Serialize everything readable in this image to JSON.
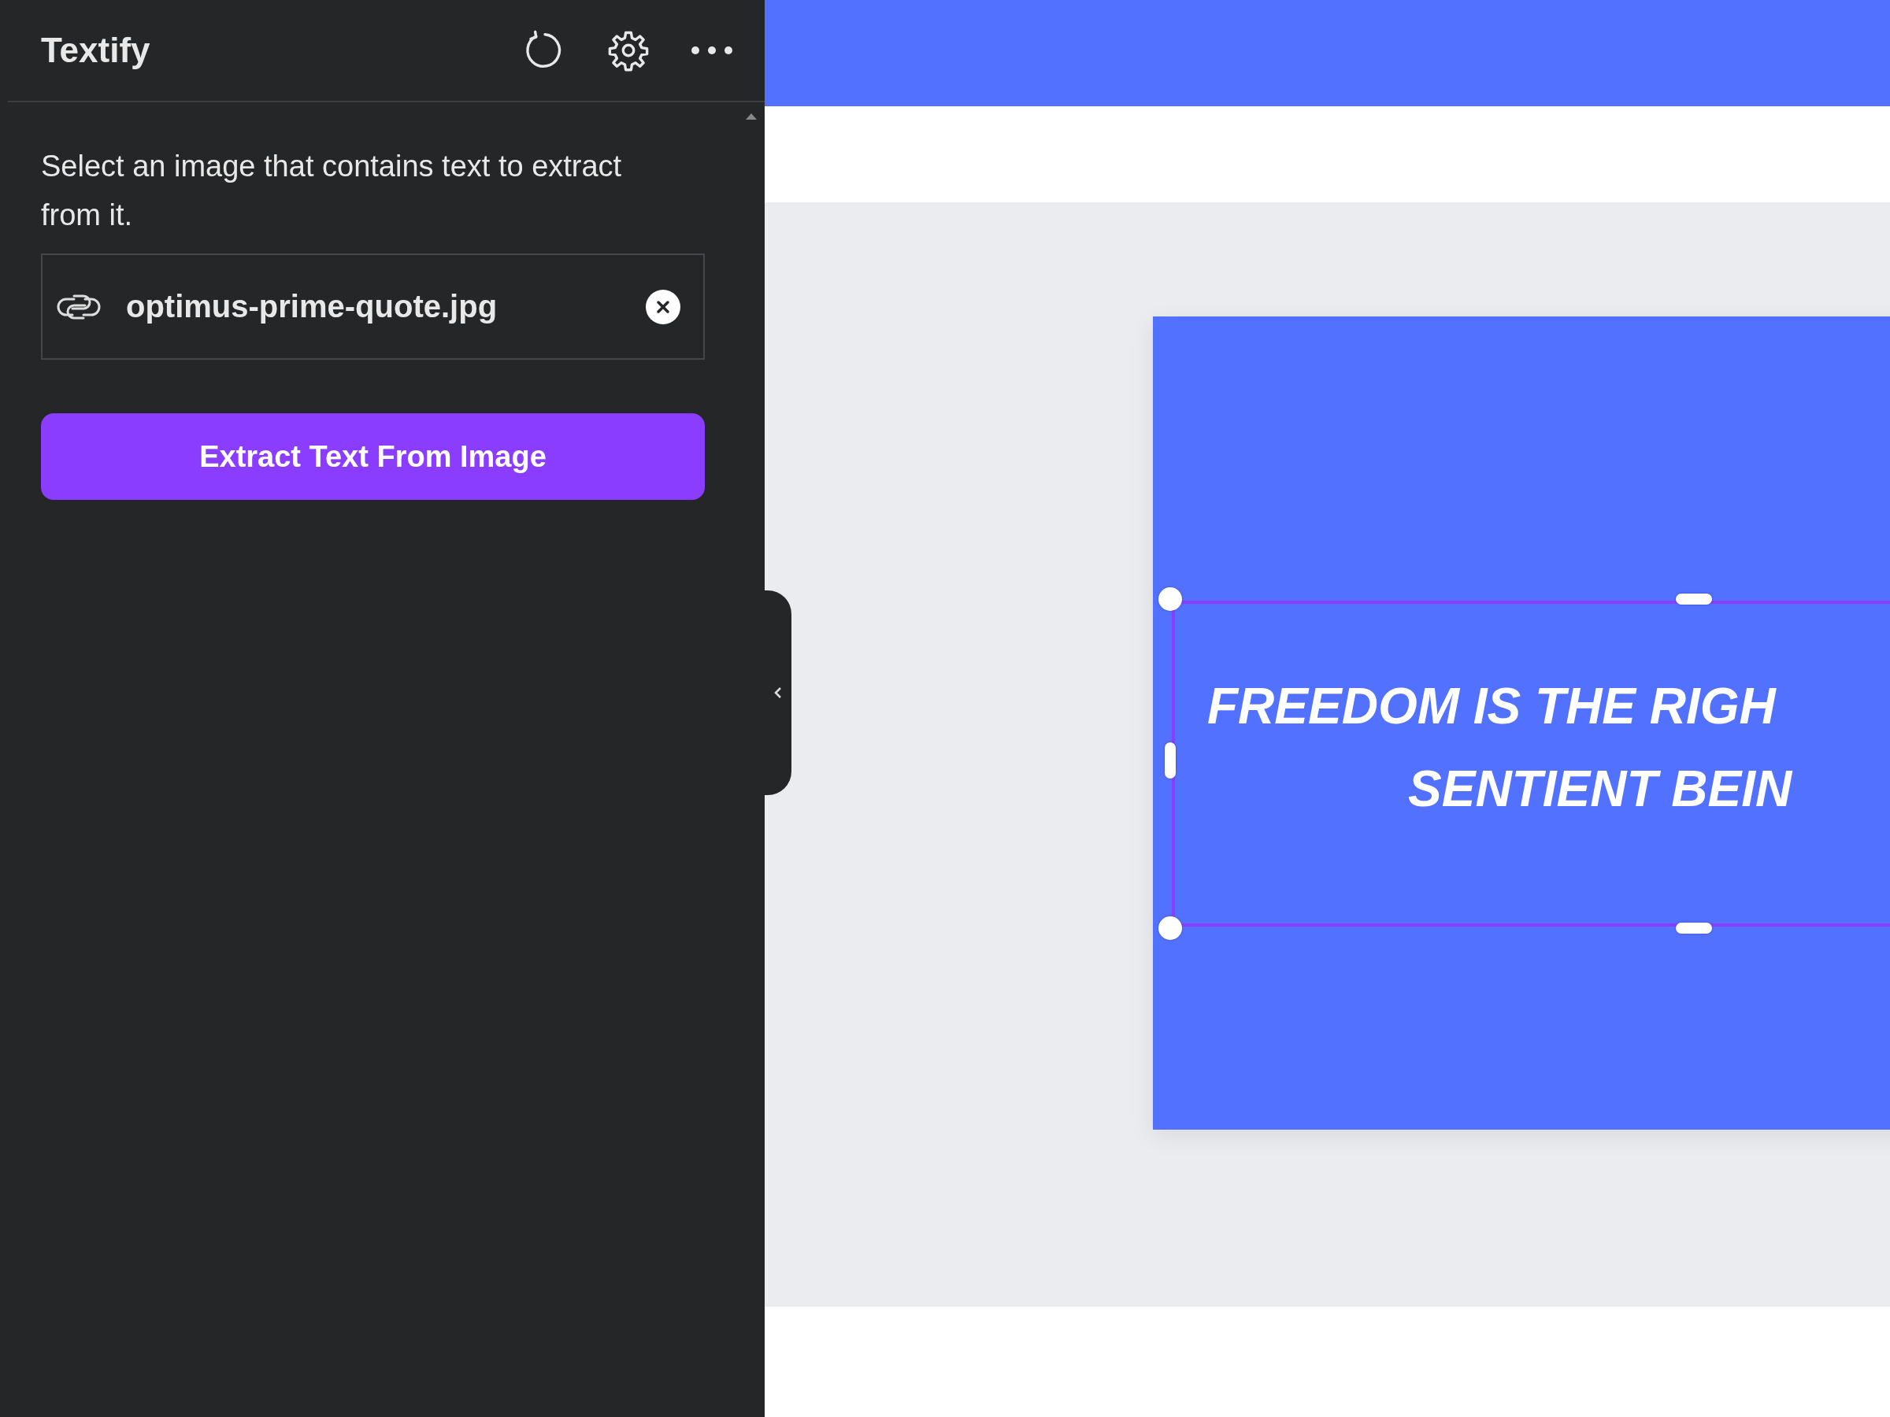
{
  "panel": {
    "title": "Textify",
    "description": "Select an image that contains text to extract from it.",
    "file_field": {
      "value": "optimus-prime-quote.jpg"
    },
    "extract_button": {
      "label": "Extract Text From Image"
    }
  },
  "design": {
    "text_element": {
      "selected": true,
      "lines": [
        "FREEDOM IS THE RIGH",
        "SENTIENT BEIN"
      ]
    }
  }
}
